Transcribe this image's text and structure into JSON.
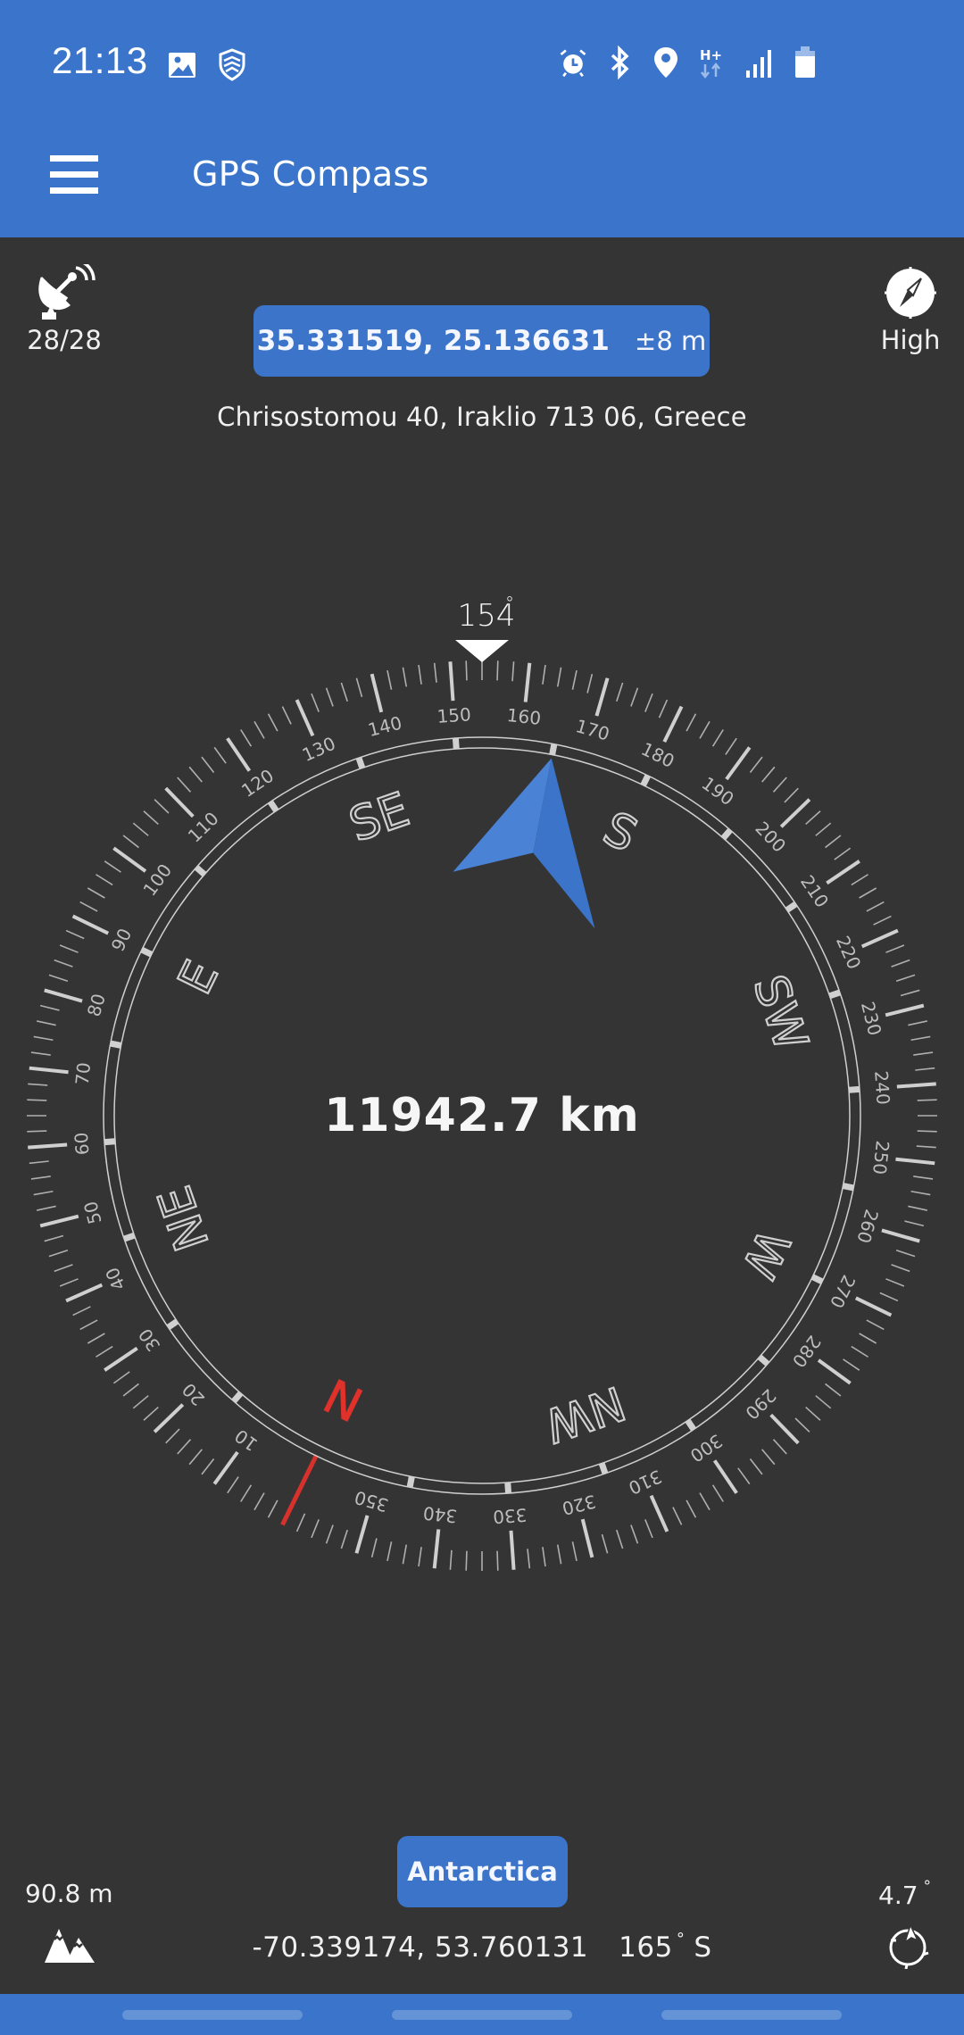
{
  "status_bar": {
    "time": "21:13",
    "left_icons": [
      "gallery-icon",
      "shield-icon"
    ],
    "right_icons": [
      "alarm-icon",
      "bluetooth-icon",
      "location-icon",
      "hplus-data-icon",
      "signal-icon",
      "battery-icon"
    ],
    "network_type": "H+"
  },
  "app_bar": {
    "menu_icon": "hamburger-menu-icon",
    "title": "GPS Compass"
  },
  "satellites": {
    "icon": "satellite-dish-icon",
    "count": "28/28"
  },
  "accuracy": {
    "icon": "compass-icon",
    "label": "High"
  },
  "location": {
    "coordinates": "35.331519, 25.136631",
    "accuracy": "±8 m",
    "address": "Chrisostomou 40, Iraklio 713 06, Greece"
  },
  "compass": {
    "heading_value": "154",
    "heading_unit": "°",
    "heading_deg": 154,
    "bearing_to_target_deg": 165,
    "distance": "11942.7 km",
    "cardinals": [
      {
        "label": "N",
        "deg": 0
      },
      {
        "label": "NE",
        "deg": 45
      },
      {
        "label": "E",
        "deg": 90
      },
      {
        "label": "SE",
        "deg": 135
      },
      {
        "label": "S",
        "deg": 180
      },
      {
        "label": "SW",
        "deg": 225
      },
      {
        "label": "W",
        "deg": 270
      },
      {
        "label": "NW",
        "deg": 315
      }
    ],
    "degree_labels": [
      "10",
      "20",
      "30",
      "40",
      "50",
      "60",
      "70",
      "80",
      "90",
      "100",
      "110",
      "120",
      "130",
      "140",
      "150",
      "160",
      "170",
      "180",
      "190",
      "200",
      "210",
      "220",
      "230",
      "240",
      "250",
      "260",
      "270",
      "280",
      "290",
      "300",
      "310",
      "320",
      "330",
      "340",
      "350"
    ],
    "colors": {
      "north": "#e0312b",
      "arrow": "#3b74c9",
      "arrow_light": "#4a82d6",
      "tick": "#d8d8d8",
      "ring": "#cfcfcf"
    }
  },
  "target": {
    "name": "Antarctica",
    "coordinates": "-70.339174, 53.760131",
    "bearing_value": "165",
    "bearing_unit": "°",
    "bearing_direction": "S"
  },
  "altitude": {
    "value": "90.8 m",
    "icon": "mountain-icon"
  },
  "declination": {
    "value": "4.7",
    "unit": "°",
    "icon": "rotate-compass-icon"
  },
  "nav_bar": {
    "handles": [
      "recent-apps",
      "home",
      "back"
    ]
  }
}
